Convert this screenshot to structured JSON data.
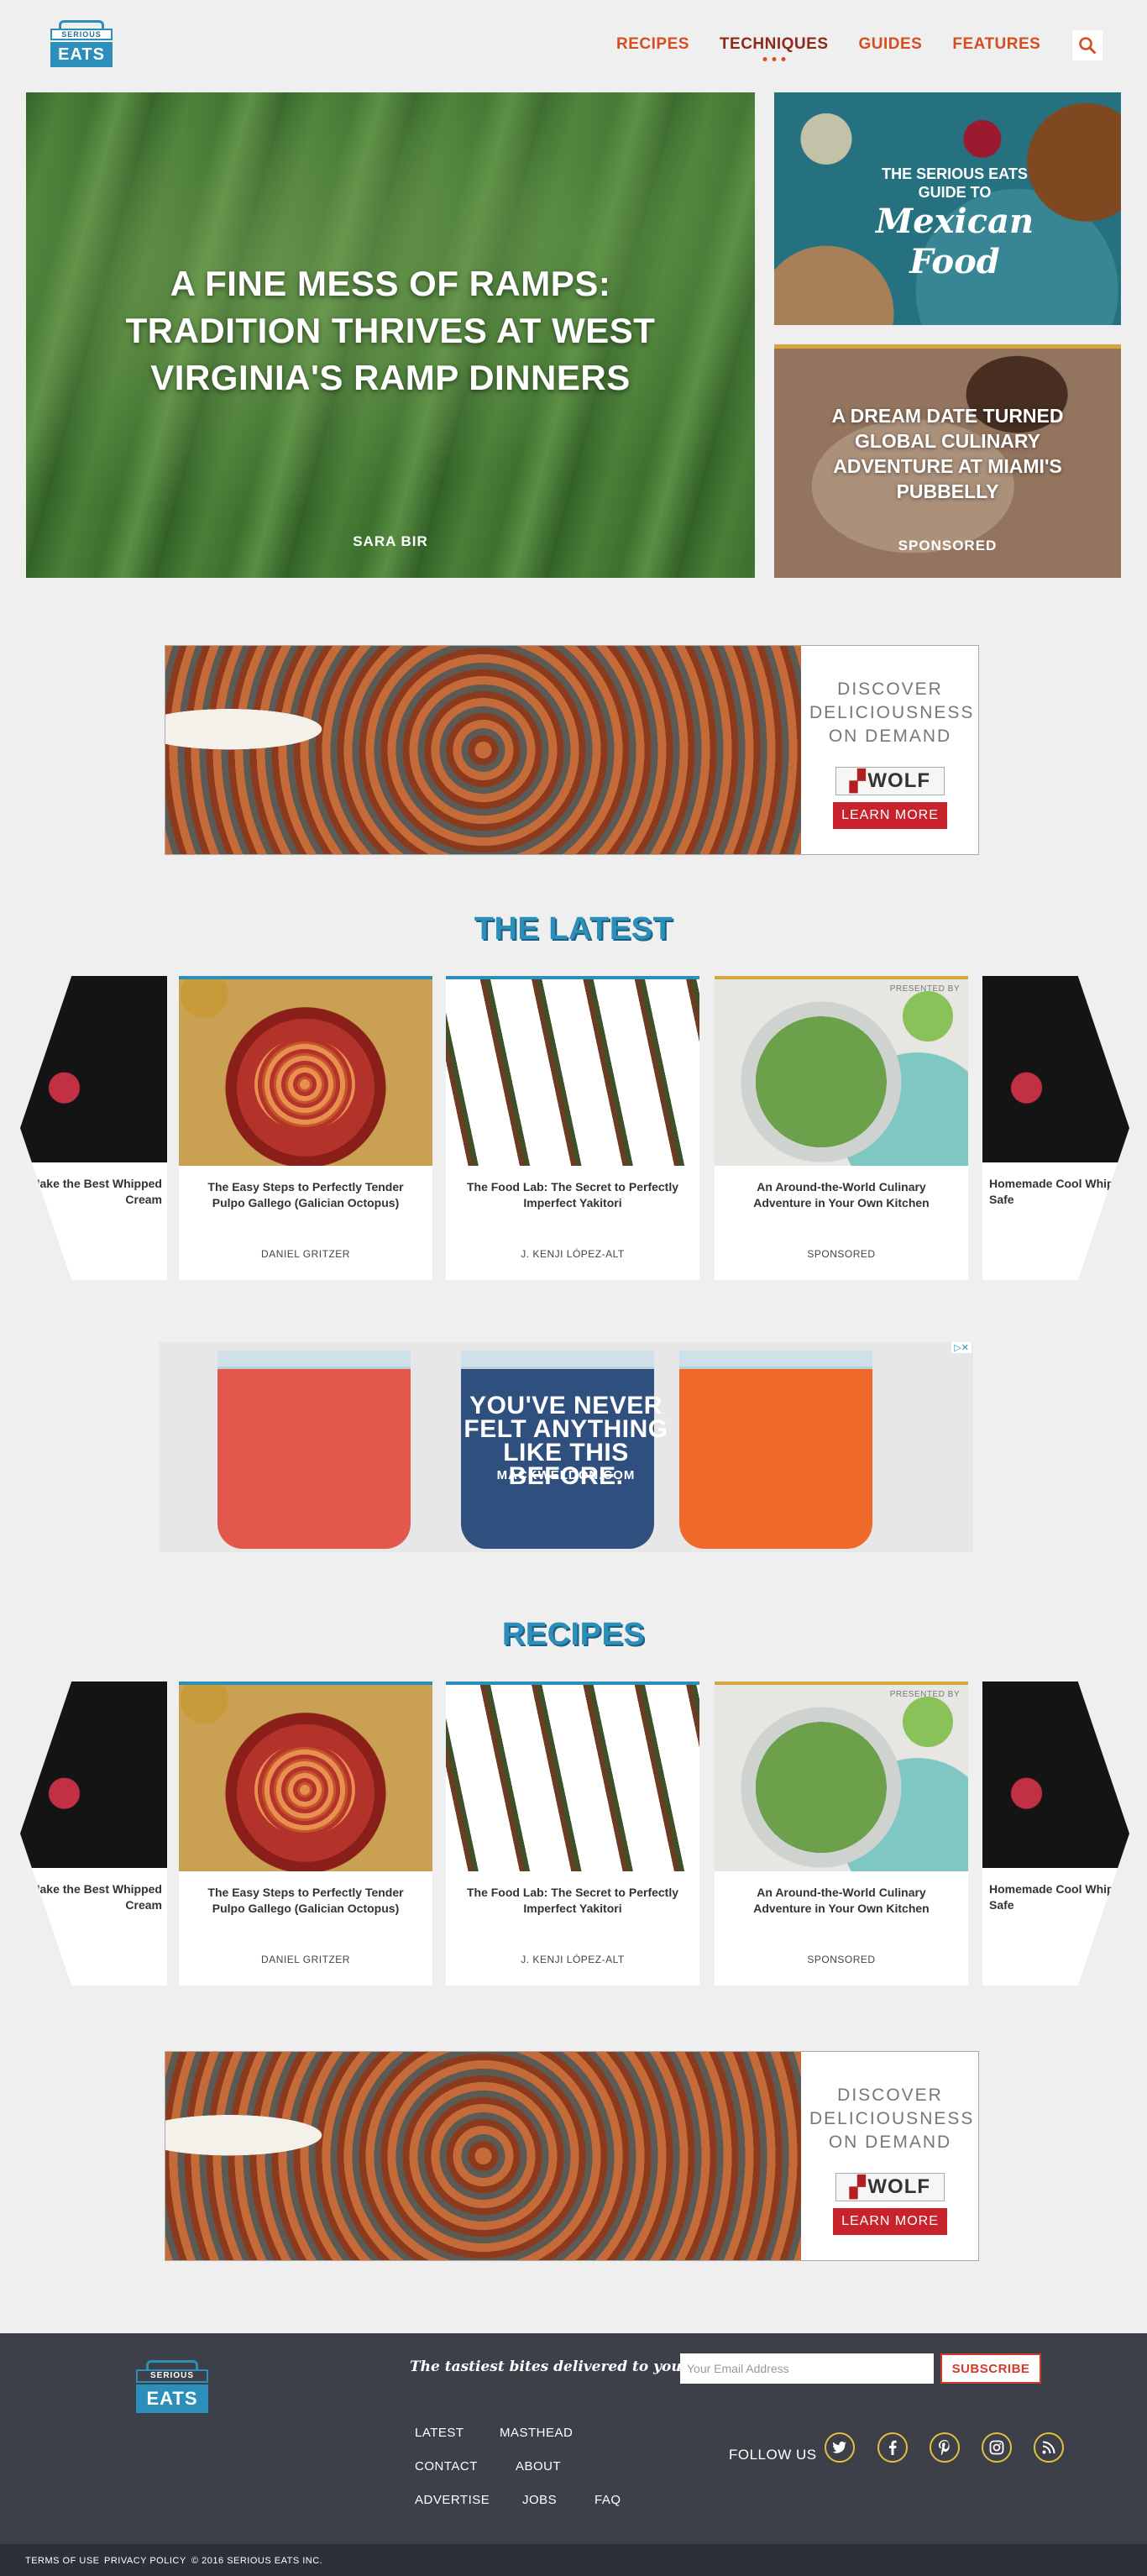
{
  "header": {
    "logo_top": "SERIOUS",
    "logo_bottom": "EATS",
    "nav": [
      {
        "label": "RECIPES"
      },
      {
        "label": "TECHNIQUES"
      },
      {
        "label": "GUIDES"
      },
      {
        "label": "FEATURES"
      }
    ],
    "active_nav": "TECHNIQUES",
    "search_icon": "search-icon"
  },
  "hero": {
    "main": {
      "title": "A FINE MESS OF RAMPS: TRADITION THRIVES AT WEST VIRGINIA'S RAMP DINNERS",
      "author": "SARA BIR"
    },
    "side1": {
      "kicker": "THE SERIOUS EATS GUIDE TO",
      "script_title": "Mexican Food"
    },
    "side2": {
      "title": "A DREAM DATE TURNED GLOBAL CULINARY ADVENTURE AT MIAMI'S PUBBELLY",
      "tag": "SPONSORED"
    }
  },
  "ads": {
    "wolf": {
      "tagline": "DISCOVER DELICIOUSNESS ON DEMAND",
      "brand": "WOLF",
      "cta": "LEARN MORE"
    },
    "mackweldon": {
      "headline": "YOU'VE NEVER FELT ANYTHING LIKE THIS BEFORE.",
      "url": "MACKWELDON.COM",
      "waistband": "MACK WELDON"
    }
  },
  "latest": {
    "title": "THE LATEST",
    "left_peek": "How to Make the Best Whipped Cream",
    "right_peek": "Homemade Cool Whip Freezer-Safe",
    "cards": [
      {
        "title": "The Easy Steps to Perfectly Tender Pulpo Gallego (Galician Octopus)",
        "byline": "DANIEL GRITZER"
      },
      {
        "title": "The Food Lab: The Secret to Perfectly Imperfect Yakitori",
        "byline": "J. KENJI LÓPEZ-ALT"
      },
      {
        "title": "An Around-the-World Culinary Adventure in Your Own Kitchen",
        "byline": "SPONSORED",
        "presented": "PRESENTED BY"
      }
    ]
  },
  "recipes": {
    "title": "RECIPES",
    "left_peek": "How to Make the Best Whipped Cream",
    "right_peek": "Homemade Cool Whip Freezer-Safe",
    "cards": [
      {
        "title": "The Easy Steps to Perfectly Tender Pulpo Gallego (Galician Octopus)",
        "byline": "DANIEL GRITZER"
      },
      {
        "title": "The Food Lab: The Secret to Perfectly Imperfect Yakitori",
        "byline": "J. KENJI LÓPEZ-ALT"
      },
      {
        "title": "An Around-the-World Culinary Adventure in Your Own Kitchen",
        "byline": "SPONSORED",
        "presented": "PRESENTED BY"
      }
    ]
  },
  "footer": {
    "logo_top": "SERIOUS",
    "logo_bottom": "EATS",
    "newsletter_label": "The tastiest bites delivered to your inbox!",
    "email_placeholder": "Your Email Address",
    "subscribe_label": "SUBSCRIBE",
    "links": [
      "LATEST",
      "MASTHEAD",
      "CONTACT",
      "ABOUT",
      "ADVERTISE",
      "JOBS",
      "FAQ"
    ],
    "follow_label": "FOLLOW US",
    "social": [
      "twitter-icon",
      "facebook-icon",
      "pinterest-icon",
      "instagram-icon",
      "rss-icon"
    ],
    "bottom_links": [
      "TERMS OF USE",
      "PRIVACY POLICY",
      "© 2016 SERIOUS EATS INC."
    ]
  },
  "colors": {
    "brand_blue": "#2b8fb9",
    "nav_orange": "#d44e1f",
    "footer_bg": "#3d4049",
    "subscribe_red": "#d23a2a",
    "social_gold": "#e0c040"
  }
}
